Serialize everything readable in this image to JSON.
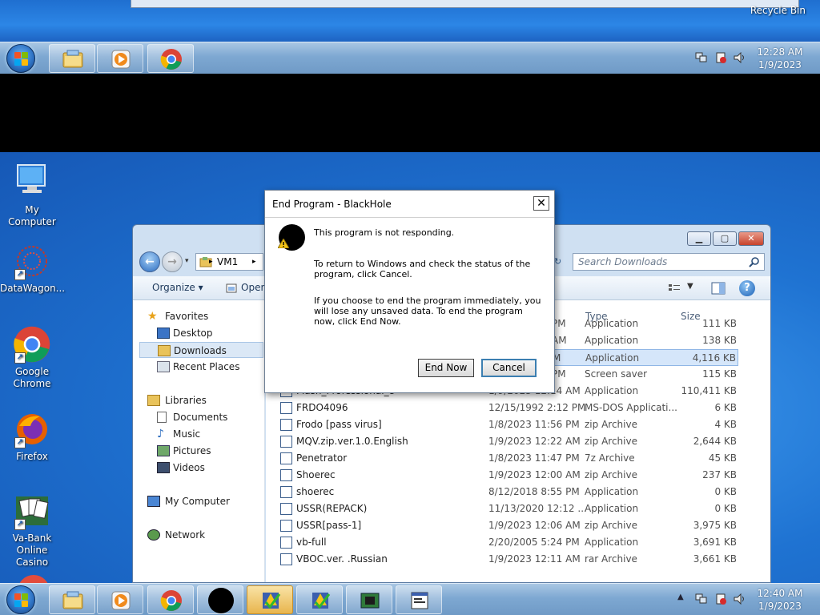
{
  "top_desktop": {
    "recycle_bin_label": "Recycle Bin"
  },
  "top_taskbar": {
    "time": "12:28 AM",
    "date": "1/9/2023"
  },
  "desktop_icons": [
    {
      "label": "My Computer"
    },
    {
      "label": "DataWagon..."
    },
    {
      "label": "Google Chrome"
    },
    {
      "label": "Firefox"
    },
    {
      "label": "Va-Bank Online Casino"
    }
  ],
  "explorer": {
    "address_path": "VM1",
    "search_placeholder": "Search Downloads",
    "toolbar": {
      "organize": "Organize ▾",
      "open": "Open"
    },
    "columns": {
      "type": "Type",
      "size": "Size"
    },
    "nav": {
      "favorites": "Favorites",
      "desktop": "Desktop",
      "downloads": "Downloads",
      "recent": "Recent Places",
      "libraries": "Libraries",
      "documents": "Documents",
      "music": "Music",
      "pictures": "Pictures",
      "videos": "Videos",
      "computer": "My Computer",
      "network": "Network"
    },
    "files": [
      {
        "name": "",
        "date": "PM",
        "type": "Application",
        "size": "111 KB"
      },
      {
        "name": "",
        "date": "AM",
        "type": "Application",
        "size": "138 KB"
      },
      {
        "name": "",
        "date": "M",
        "type": "Application",
        "size": "4,116 KB"
      },
      {
        "name": "",
        "date": "PM",
        "type": "Screen saver",
        "size": "115 KB"
      },
      {
        "name": "Flash_Professional_8",
        "date": "1/9/2023 12:14 AM",
        "type": "Application",
        "size": "110,411 KB"
      },
      {
        "name": "FRDO4096",
        "date": "12/15/1992 2:12 PM",
        "type": "MS-DOS Applicati...",
        "size": "6 KB"
      },
      {
        "name": "Frodo [pass virus]",
        "date": "1/8/2023 11:56 PM",
        "type": "zip Archive",
        "size": "4 KB"
      },
      {
        "name": "MQV.zip.ver.1.0.English",
        "date": "1/9/2023 12:22 AM",
        "type": "zip Archive",
        "size": "2,644 KB"
      },
      {
        "name": "Penetrator",
        "date": "1/8/2023 11:47 PM",
        "type": "7z Archive",
        "size": "45 KB"
      },
      {
        "name": "Shoerec",
        "date": "1/9/2023 12:00 AM",
        "type": "zip Archive",
        "size": "237 KB"
      },
      {
        "name": "shoerec",
        "date": "8/12/2018 8:55 PM",
        "type": "Application",
        "size": "0 KB"
      },
      {
        "name": "USSR(REPACK)",
        "date": "11/13/2020 12:12 ...",
        "type": "Application",
        "size": "0 KB"
      },
      {
        "name": "USSR[pass-1]",
        "date": "1/9/2023 12:06 AM",
        "type": "zip Archive",
        "size": "3,975 KB"
      },
      {
        "name": "vb-full",
        "date": "2/20/2005 5:24 PM",
        "type": "Application",
        "size": "3,691 KB"
      },
      {
        "name": "VBOC.ver. .Russian",
        "date": "1/9/2023 12:11 AM",
        "type": "rar Archive",
        "size": "3,661 KB"
      }
    ]
  },
  "dialog": {
    "title": "End Program - BlackHole",
    "close": "✕",
    "line1": "This program is not responding.",
    "line2": "To return to Windows and check the status of the program, click Cancel.",
    "line3": "If you choose to end the program immediately, you will lose any unsaved data. To end the program now, click End Now.",
    "end_now": "End Now",
    "cancel": "Cancel"
  },
  "bottom_taskbar": {
    "time": "12:40 AM",
    "date": "1/9/2023"
  },
  "colors": {
    "taskbar": "#7ea8d2",
    "desktop": "#1f73d2",
    "selection": "#d5e6fa"
  }
}
